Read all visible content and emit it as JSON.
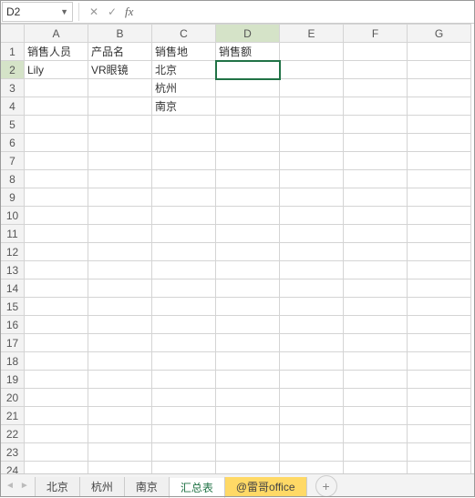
{
  "nameBox": {
    "value": "D2"
  },
  "formula": {
    "value": ""
  },
  "columns": [
    "A",
    "B",
    "C",
    "D",
    "E",
    "F",
    "G"
  ],
  "rowCount": 24,
  "activeCell": {
    "row": 2,
    "col": 4
  },
  "cells": {
    "r1c1": "销售人员",
    "r1c2": "产品名",
    "r1c3": "销售地",
    "r1c4": "销售额",
    "r2c1": "Lily",
    "r2c2": "VR眼镜",
    "r2c3": "北京",
    "r3c3": "杭州",
    "r4c3": "南京"
  },
  "tabs": [
    {
      "label": "北京",
      "state": ""
    },
    {
      "label": "杭州",
      "state": ""
    },
    {
      "label": "南京",
      "state": ""
    },
    {
      "label": "汇总表",
      "state": "active"
    },
    {
      "label": "@雷哥office",
      "state": "highlight"
    }
  ],
  "icons": {
    "cancel": "✕",
    "confirm": "✓",
    "fx": "fx",
    "add": "+"
  }
}
